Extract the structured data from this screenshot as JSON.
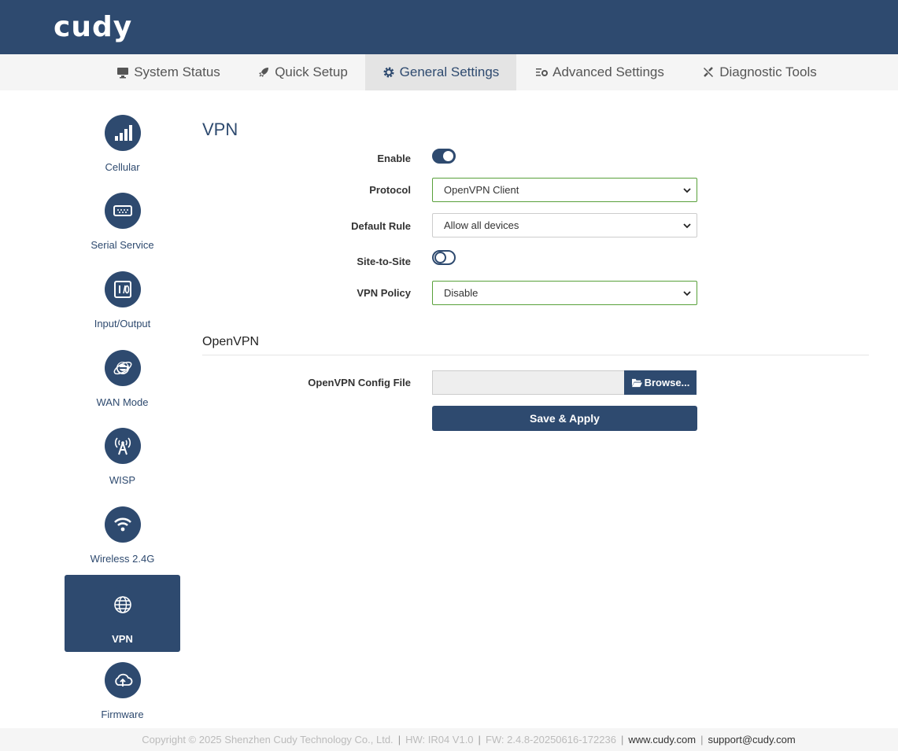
{
  "brand": {
    "logo": "cudy"
  },
  "nav": {
    "tabs": [
      {
        "label": "System Status",
        "icon": "monitor-icon"
      },
      {
        "label": "Quick Setup",
        "icon": "rocket-icon"
      },
      {
        "label": "General Settings",
        "icon": "gear-icon",
        "active": true
      },
      {
        "label": "Advanced Settings",
        "icon": "sliders-gear-icon"
      },
      {
        "label": "Diagnostic Tools",
        "icon": "tools-icon"
      }
    ]
  },
  "sidebar": {
    "items": [
      {
        "label": "Cellular",
        "icon": "signal-bars-icon"
      },
      {
        "label": "Serial Service",
        "icon": "serial-port-icon"
      },
      {
        "label": "Input/Output",
        "icon": "io-icon"
      },
      {
        "label": "WAN Mode",
        "icon": "internet-e-icon"
      },
      {
        "label": "WISP",
        "icon": "antenna-icon"
      },
      {
        "label": "Wireless 2.4G",
        "icon": "wifi-icon"
      },
      {
        "label": "VPN",
        "icon": "globe-icon",
        "active": true
      },
      {
        "label": "Firmware",
        "icon": "cloud-upload-icon"
      }
    ]
  },
  "vpn": {
    "title": "VPN",
    "enable_label": "Enable",
    "enable_on": true,
    "protocol_label": "Protocol",
    "protocol_value": "OpenVPN Client",
    "default_rule_label": "Default Rule",
    "default_rule_value": "Allow all devices",
    "site_label": "Site-to-Site",
    "site_on": false,
    "policy_label": "VPN Policy",
    "policy_value": "Disable"
  },
  "openvpn": {
    "title": "OpenVPN",
    "config_label": "OpenVPN Config File",
    "browse_label": "Browse...",
    "save_label": "Save & Apply"
  },
  "footer": {
    "copyright": "Copyright © 2025 Shenzhen Cudy Technology Co., Ltd.",
    "hw": "HW: IR04 V1.0",
    "fw": "FW: 2.4.8-20250616-172236",
    "website": "www.cudy.com",
    "email": "support@cudy.com"
  },
  "colors": {
    "primary": "#2e4a6f",
    "valid_border": "#58a03a"
  }
}
